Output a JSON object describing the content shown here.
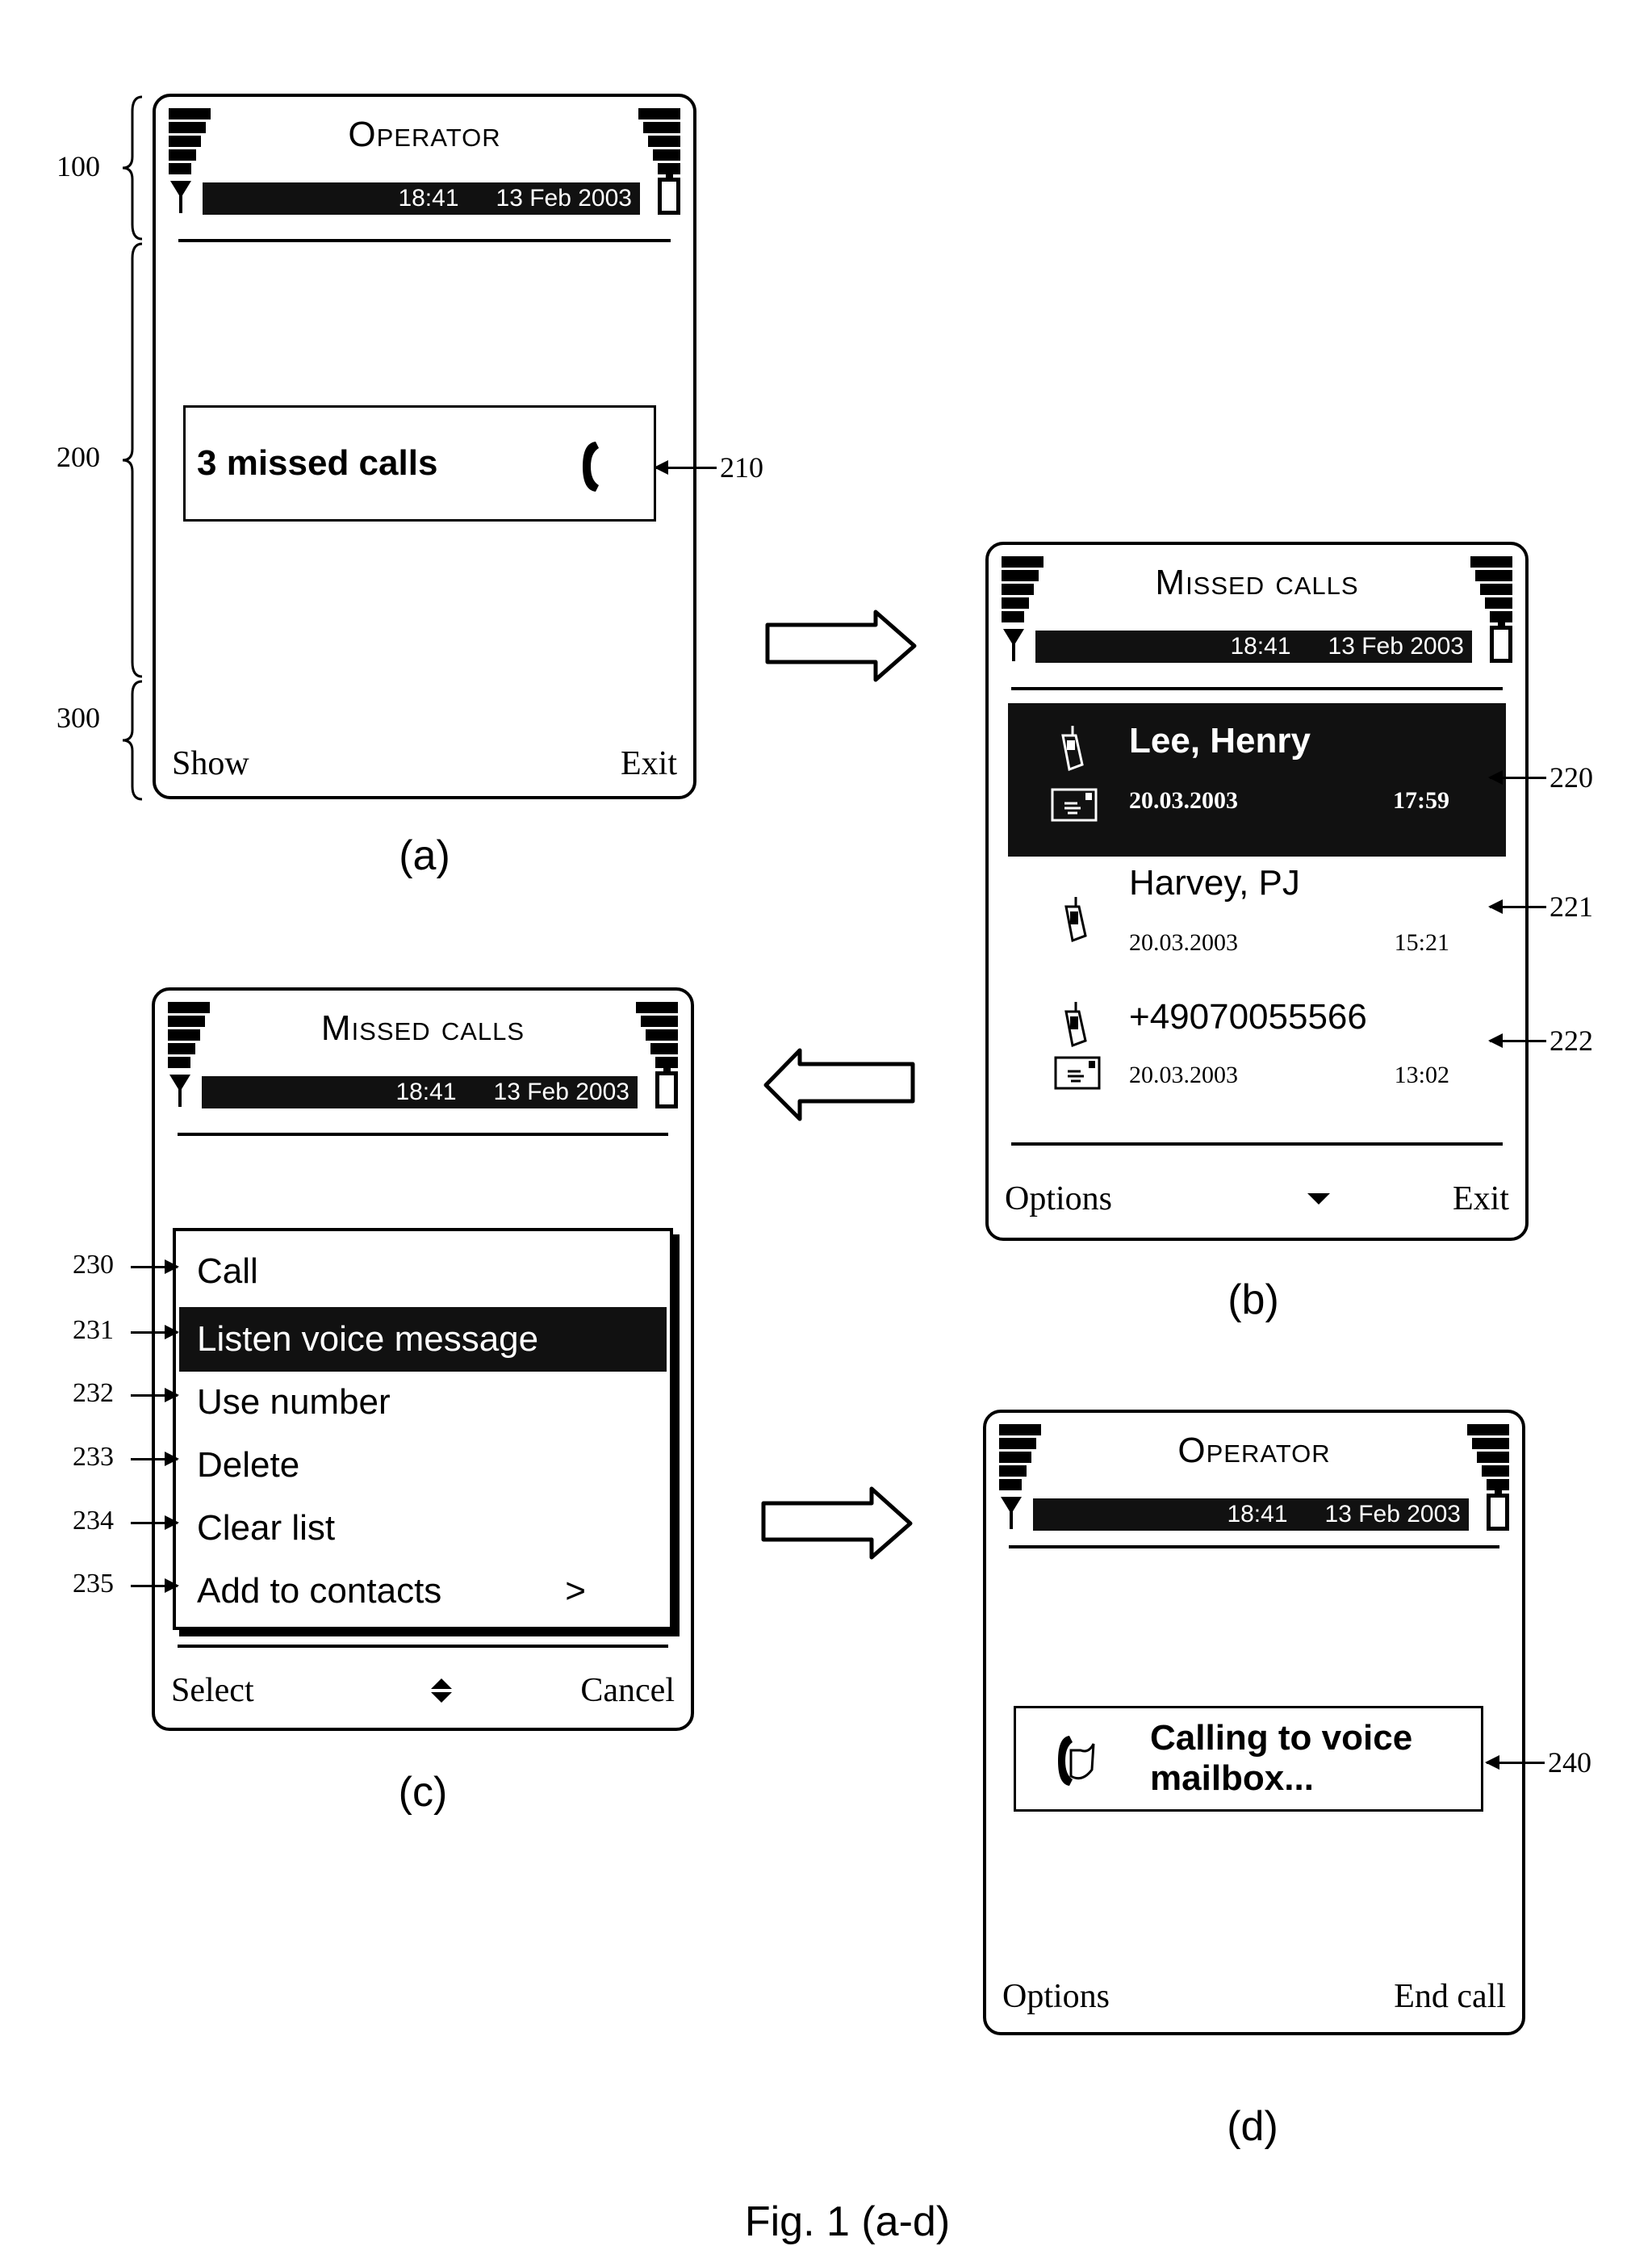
{
  "figure_caption": "Fig. 1 (a-d)",
  "status": {
    "time": "18:41",
    "date": "13 Feb 2003"
  },
  "left_refs": {
    "header": "100",
    "content": "200",
    "softkeys": "300"
  },
  "panel_a": {
    "label": "(a)",
    "title": "Operator",
    "note": {
      "text": "3 missed calls",
      "icon": "phone-handset-icon",
      "ref": "210"
    },
    "softkeys": {
      "left": "Show",
      "right": "Exit"
    }
  },
  "panel_b": {
    "label": "(b)",
    "title": "Missed calls",
    "items": [
      {
        "name": "Lee, Henry",
        "date": "20.03.2003",
        "time": "17:59",
        "icons": [
          "mobile-phone-icon",
          "voice-message-icon"
        ],
        "selected": true,
        "ref": "220"
      },
      {
        "name": "Harvey, PJ",
        "date": "20.03.2003",
        "time": "15:21",
        "icons": [
          "mobile-phone-icon"
        ],
        "selected": false,
        "ref": "221"
      },
      {
        "name": "+49070055566",
        "date": "20.03.2003",
        "time": "13:02",
        "icons": [
          "mobile-phone-icon",
          "voice-message-icon"
        ],
        "selected": false,
        "ref": "222"
      }
    ],
    "softkeys": {
      "left": "Options",
      "center_icon": "scroll-down-icon",
      "right": "Exit"
    }
  },
  "panel_c": {
    "label": "(c)",
    "title": "Missed calls",
    "menu": [
      {
        "label": "Call",
        "ref": "230",
        "selected": false,
        "submenu": ""
      },
      {
        "label": "Listen voice message",
        "ref": "231",
        "selected": true,
        "submenu": ""
      },
      {
        "label": "Use number",
        "ref": "232",
        "selected": false,
        "submenu": ""
      },
      {
        "label": "Delete",
        "ref": "233",
        "selected": false,
        "submenu": ""
      },
      {
        "label": "Clear list",
        "ref": "234",
        "selected": false,
        "submenu": ""
      },
      {
        "label": "Add to contacts",
        "ref": "235",
        "selected": false,
        "submenu": ">"
      }
    ],
    "softkeys": {
      "left": "Select",
      "center_icon": "scroll-up-down-icon",
      "right": "Cancel"
    }
  },
  "panel_d": {
    "label": "(d)",
    "title": "Operator",
    "note": {
      "line1": "Calling to voice",
      "line2": "mailbox...",
      "icon": "voicemail-call-icon",
      "ref": "240"
    },
    "softkeys": {
      "left": "Options",
      "right": "End call"
    }
  },
  "flow_arrows": [
    {
      "from": "a",
      "to": "b",
      "direction": "right"
    },
    {
      "from": "b",
      "to": "c",
      "direction": "left"
    },
    {
      "from": "c",
      "to": "d",
      "direction": "right"
    }
  ]
}
